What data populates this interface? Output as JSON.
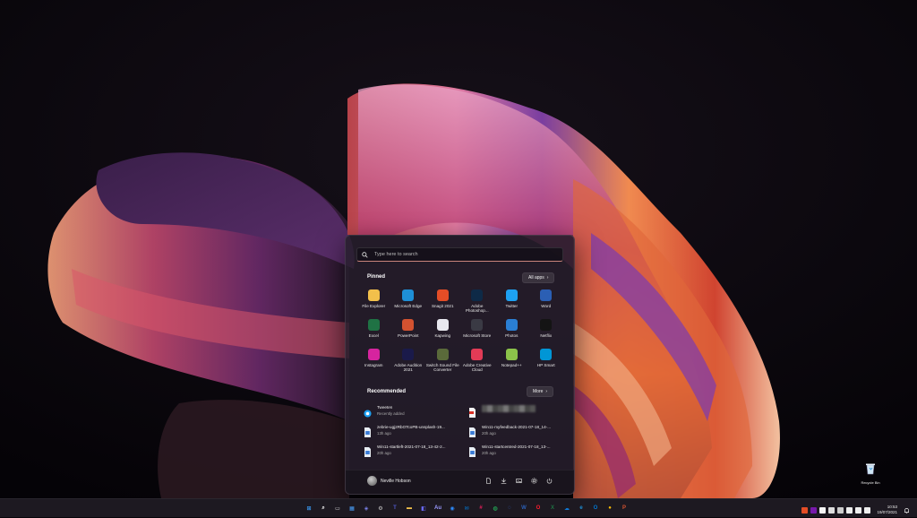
{
  "start_menu": {
    "search_placeholder": "Type here to search",
    "pinned_heading": "Pinned",
    "all_apps_label": "All apps",
    "pinned_apps": [
      {
        "label": "File Explorer",
        "icon": "folder-icon",
        "color": "#f2c04b"
      },
      {
        "label": "Microsoft Edge",
        "icon": "edge-icon",
        "color": "#1e8fd6"
      },
      {
        "label": "Snagit 2021",
        "icon": "snagit-icon",
        "color": "#e44d26"
      },
      {
        "label": "Adobe Photoshop...",
        "icon": "photoshop-icon",
        "color": "#0e2a47"
      },
      {
        "label": "Twitter",
        "icon": "twitter-icon",
        "color": "#1da1f2"
      },
      {
        "label": "Word",
        "icon": "word-icon",
        "color": "#2b5fb4"
      },
      {
        "label": "Excel",
        "icon": "excel-icon",
        "color": "#1f7244"
      },
      {
        "label": "PowerPoint",
        "icon": "powerpoint-icon",
        "color": "#d35230"
      },
      {
        "label": "Kapwing",
        "icon": "kapwing-icon",
        "color": "#e8e8ef"
      },
      {
        "label": "Microsoft Store",
        "icon": "store-icon",
        "color": "#3a3a44"
      },
      {
        "label": "Photos",
        "icon": "photos-icon",
        "color": "#2a7fd4"
      },
      {
        "label": "Netflix",
        "icon": "netflix-icon",
        "color": "#141414"
      },
      {
        "label": "Instagram",
        "icon": "instagram-icon",
        "color": "#d6249f"
      },
      {
        "label": "Adobe Audition 2021",
        "icon": "audition-icon",
        "color": "#1a1a4a"
      },
      {
        "label": "Switch Sound File Converter",
        "icon": "switch-icon",
        "color": "#5a6a3a"
      },
      {
        "label": "Adobe Creative Cloud",
        "icon": "creative-cloud-icon",
        "color": "#e23b56"
      },
      {
        "label": "Notepad++",
        "icon": "notepad-icon",
        "color": "#8bc34a"
      },
      {
        "label": "HP Smart",
        "icon": "hp-smart-icon",
        "color": "#0096d6"
      }
    ],
    "recommended_heading": "Recommended",
    "more_label": "More",
    "recommended": [
      {
        "name": "Tweeten",
        "time": "Recently added",
        "icon": "tweeten-icon"
      },
      {
        "name": "",
        "time": "",
        "icon": "pdf-icon"
      },
      {
        "name": "zebrie-ugj2RbOTcoPB-unsplash-19...",
        "time": "13h ago",
        "icon": "image-file-icon"
      },
      {
        "name": "Win11-myfeedback-2021-07-18_14-...",
        "time": "20h ago",
        "icon": "image-file-icon"
      },
      {
        "name": "Win11-startleft-2021-07-18_13-42-2...",
        "time": "20h ago",
        "icon": "image-file-icon"
      },
      {
        "name": "Win11-startcentred-2021-07-18_13-...",
        "time": "20h ago",
        "icon": "image-file-icon"
      }
    ],
    "user_name": "Neville Hobson"
  },
  "desktop": {
    "recycle_bin_label": "Recycle Bin"
  },
  "taskbar": {
    "apps": [
      {
        "icon": "windows-icon",
        "color": "#3aa0ff",
        "glyph": "⊞"
      },
      {
        "icon": "search-icon",
        "color": "#ffffff",
        "glyph": "⌕"
      },
      {
        "icon": "task-view-icon",
        "color": "#dddddd",
        "glyph": "▭"
      },
      {
        "icon": "widgets-icon",
        "color": "#4aa3ff",
        "glyph": "▦"
      },
      {
        "icon": "chat-icon",
        "color": "#7b83eb",
        "glyph": "◈"
      },
      {
        "icon": "settings-icon",
        "color": "#cccccc",
        "glyph": "⚙"
      },
      {
        "icon": "teams-icon",
        "color": "#5059c9",
        "glyph": "T"
      },
      {
        "icon": "file-explorer-icon",
        "color": "#f2c04b",
        "glyph": "▬"
      },
      {
        "icon": "store-icon",
        "color": "#6b6bff",
        "glyph": "◧"
      },
      {
        "icon": "audition-icon",
        "color": "#9999ff",
        "glyph": "Au"
      },
      {
        "icon": "zoom-icon",
        "color": "#2d8cff",
        "glyph": "◉"
      },
      {
        "icon": "email-icon",
        "color": "#0078d4",
        "glyph": "✉"
      },
      {
        "icon": "slack-icon",
        "color": "#e01e5a",
        "glyph": "#"
      },
      {
        "icon": "whatsapp-icon",
        "color": "#25d366",
        "glyph": "◍"
      },
      {
        "icon": "signal-icon",
        "color": "#3a76f0",
        "glyph": "◌"
      },
      {
        "icon": "word-icon",
        "color": "#2b5fb4",
        "glyph": "W"
      },
      {
        "icon": "opera-icon",
        "color": "#ff1b2d",
        "glyph": "O"
      },
      {
        "icon": "excel-icon",
        "color": "#1f7244",
        "glyph": "X"
      },
      {
        "icon": "onedrive-icon",
        "color": "#0f78d4",
        "glyph": "☁"
      },
      {
        "icon": "edge-icon",
        "color": "#1e8fd6",
        "glyph": "e"
      },
      {
        "icon": "outlook-icon",
        "color": "#0078d4",
        "glyph": "O"
      },
      {
        "icon": "chrome-icon",
        "color": "#fbbc05",
        "glyph": "●"
      },
      {
        "icon": "powerpoint-icon",
        "color": "#d35230",
        "glyph": "P"
      }
    ],
    "tray_icons": [
      {
        "icon": "html-icon",
        "color": "#e44d26"
      },
      {
        "icon": "onenote-icon",
        "color": "#7719aa"
      },
      {
        "icon": "cloud-icon",
        "color": "#f5f5f5"
      },
      {
        "icon": "onedrive-tray-icon",
        "color": "#dddddd"
      },
      {
        "icon": "chevron-up-icon",
        "color": "#cccccc"
      },
      {
        "icon": "wifi-icon",
        "color": "#eeeeee"
      },
      {
        "icon": "volume-icon",
        "color": "#eeeeee"
      },
      {
        "icon": "battery-icon",
        "color": "#eeeeee"
      }
    ],
    "time": "10:53",
    "date": "19/07/2021"
  }
}
